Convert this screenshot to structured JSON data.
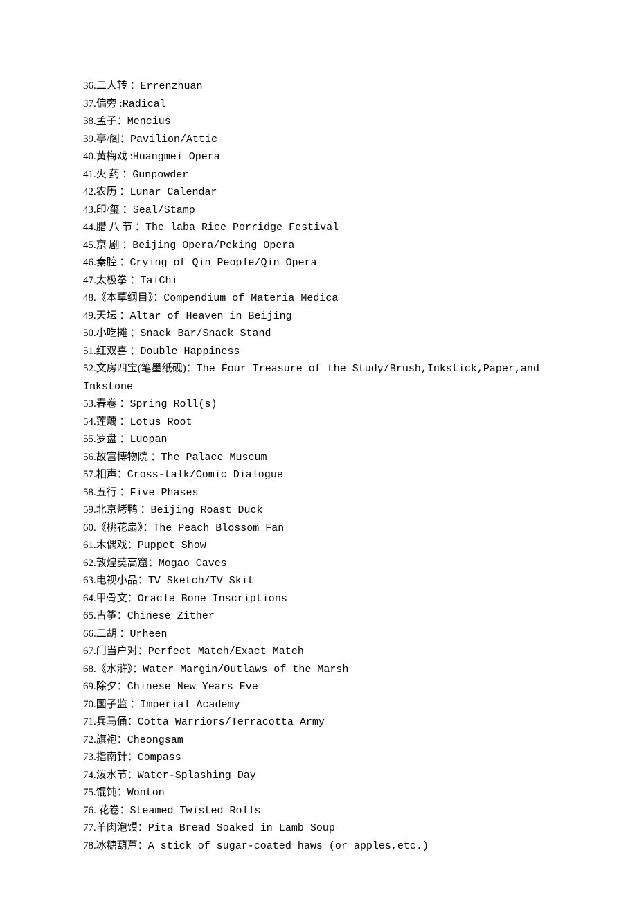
{
  "entries": [
    {
      "idx": 36,
      "term": "二人转",
      "sep": " ：",
      "def": "Errenzhuan"
    },
    {
      "idx": 37,
      "term": "偏旁",
      "sep": " :",
      "def": "Radical"
    },
    {
      "idx": 38,
      "term": "孟子",
      "sep": "：",
      "def": "Mencius"
    },
    {
      "idx": 39,
      "term": "亭/阁",
      "sep": "：",
      "def": "Pavilion/Attic"
    },
    {
      "idx": 40,
      "term": "黄梅戏",
      "sep": " :",
      "def": "Huangmei Opera"
    },
    {
      "idx": 41,
      "term": "火 药",
      "sep": " ：",
      "def": "Gunpowder"
    },
    {
      "idx": 42,
      "term": "农历",
      "sep": " ：",
      "def": "Lunar Calendar"
    },
    {
      "idx": 43,
      "term": "印/玺",
      "sep": " ：",
      "def": "Seal/Stamp"
    },
    {
      "idx": 44,
      "term": "腊 八 节",
      "sep": " ：",
      "def": "The laba Rice Porridge Festival"
    },
    {
      "idx": 45,
      "term": "京 剧",
      "sep": " ：",
      "def": "Beijing Opera/Peking Opera"
    },
    {
      "idx": 46,
      "term": "秦腔",
      "sep": " ：",
      "def": "Crying of Qin People/Qin Opera"
    },
    {
      "idx": 47,
      "term": "太极拳",
      "sep": " ：",
      "def": "TaiChi"
    },
    {
      "idx": 48,
      "term": "《本草纲目》",
      "sep": "：",
      "def": "Compendium of Materia Medica"
    },
    {
      "idx": 49,
      "term": "天坛",
      "sep": " ：",
      "def": "Altar of Heaven in Beijing"
    },
    {
      "idx": 50,
      "term": "小吃摊",
      "sep": " ：",
      "def": "Snack Bar/Snack Stand"
    },
    {
      "idx": 51,
      "term": "红双喜",
      "sep": " ：",
      "def": "Double Happiness"
    },
    {
      "idx": 52,
      "term": "文房四宝(笔墨纸砚)",
      "sep": "：",
      "def": "The Four Treasure of the Study/Brush,Inkstick,Paper,and Inkstone"
    },
    {
      "idx": 53,
      "term": "春卷",
      "sep": " ：",
      "def": "Spring Roll(s)"
    },
    {
      "idx": 54,
      "term": "莲藕",
      "sep": " ：",
      "def": "Lotus Root"
    },
    {
      "idx": 55,
      "term": "罗盘",
      "sep": " ：",
      "def": "Luopan"
    },
    {
      "idx": 56,
      "term": "故宫博物院",
      "sep": " ：",
      "def": "The Palace Museum"
    },
    {
      "idx": 57,
      "term": "相声",
      "sep": "：",
      "def": "Cross-talk/Comic Dialogue"
    },
    {
      "idx": 58,
      "term": "五行",
      "sep": " ：",
      "def": "Five Phases"
    },
    {
      "idx": 59,
      "term": "北京烤鸭",
      "sep": " ：",
      "def": "Beijing Roast Duck"
    },
    {
      "idx": 60,
      "term": "《桃花扇》",
      "sep": "：",
      "def": "The Peach Blossom Fan"
    },
    {
      "idx": 61,
      "term": "木偶戏",
      "sep": "：",
      "def": "Puppet Show"
    },
    {
      "idx": 62,
      "term": "敦煌莫高窟",
      "sep": "：",
      "def": "Mogao Caves"
    },
    {
      "idx": 63,
      "term": "电视小品",
      "sep": "：",
      "def": "TV Sketch/TV Skit"
    },
    {
      "idx": 64,
      "term": "甲骨文",
      "sep": "：",
      "def": "Oracle Bone Inscriptions"
    },
    {
      "idx": 65,
      "term": "古筝",
      "sep": "：",
      "def": "Chinese Zither"
    },
    {
      "idx": 66,
      "term": "二胡",
      "sep": " ：",
      "def": "Urheen"
    },
    {
      "idx": 67,
      "term": "门当户对",
      "sep": "：",
      "def": "Perfect Match/Exact Match"
    },
    {
      "idx": 68,
      "term": "《水浒》",
      "sep": "：",
      "def": "Water Margin/Outlaws of the Marsh"
    },
    {
      "idx": 69,
      "term": "除夕",
      "sep": "：",
      "def": "Chinese New Years Eve"
    },
    {
      "idx": 70,
      "term": "国子监",
      "sep": " ：",
      "def": "Imperial Academy"
    },
    {
      "idx": 71,
      "term": "兵马俑",
      "sep": "：",
      "def": "Cotta Warriors/Terracotta Army"
    },
    {
      "idx": 72,
      "term": "旗袍",
      "sep": "：",
      "def": "Cheongsam"
    },
    {
      "idx": 73,
      "term": "指南针",
      "sep": "：",
      "def": "Compass"
    },
    {
      "idx": 74,
      "term": "泼水节",
      "sep": "：",
      "def": "Water-Splashing Day"
    },
    {
      "idx": 75,
      "term": "馄饨",
      "sep": "：",
      "def": "Wonton"
    },
    {
      "idx": 76,
      "term": " 花卷",
      "sep": "：",
      "def": "Steamed Twisted Rolls"
    },
    {
      "idx": 77,
      "term": "羊肉泡馍",
      "sep": "：",
      "def": "Pita Bread Soaked in Lamb Soup"
    },
    {
      "idx": 78,
      "term": "冰糖葫芦",
      "sep": "：",
      "def": "A stick of sugar-coated haws (or apples,etc.)"
    }
  ]
}
